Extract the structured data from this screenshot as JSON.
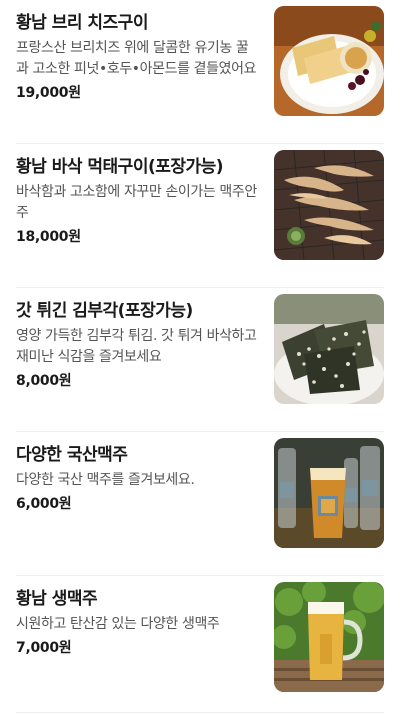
{
  "menu": {
    "items": [
      {
        "name": "황남 브리 치즈구이",
        "description": "프랑스산 브리치즈 위에 달콤한 유기농 꿀과 고소한 피넛•호두•아몬드를 곁들였어요",
        "price": "19,000원",
        "image_icon": "brie-cheese-plate-photo"
      },
      {
        "name": "황남 바삭 먹태구이(포장가능)",
        "description": "바삭함과 고소함에 자꾸만 손이가는 맥주안주",
        "price": "18,000원",
        "image_icon": "dried-pollack-photo"
      },
      {
        "name": "갓 튀긴 김부각(포장가능)",
        "description": "영양 가득한 김부각 튀김. 갓 튀겨 바삭하고 재미난 식감을 즐겨보세요",
        "price": "8,000원",
        "image_icon": "seaweed-chips-photo"
      },
      {
        "name": "다양한 국산맥주",
        "description": "다양한 국산 맥주를 즐겨보세요.",
        "price": "6,000원",
        "image_icon": "craft-beer-bottles-photo"
      },
      {
        "name": "황남 생맥주",
        "description": "시원하고 탄산감 있는 다양한 생맥주",
        "price": "7,000원",
        "image_icon": "draft-beer-mug-photo"
      }
    ]
  }
}
